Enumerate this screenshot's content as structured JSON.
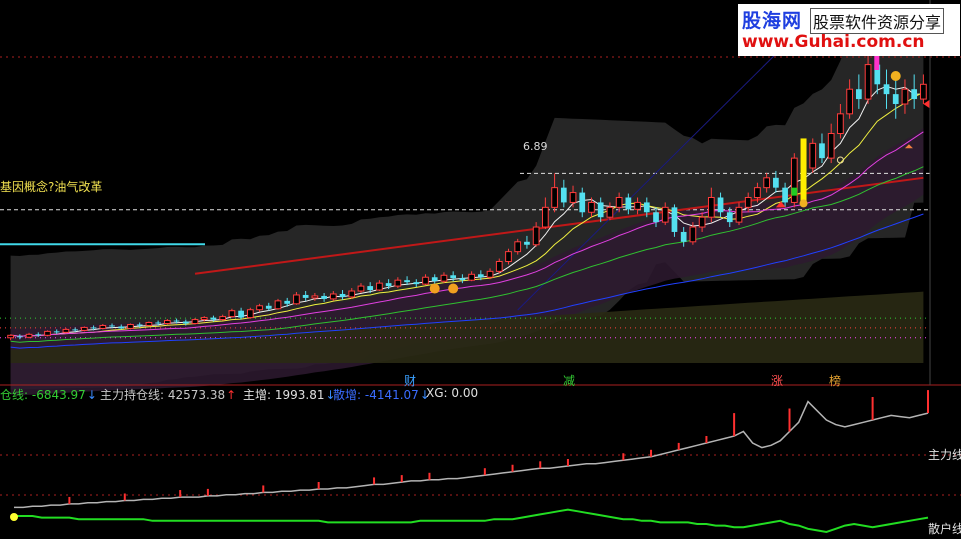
{
  "watermark": {
    "brand": "股海网",
    "tagline": "股票软件资源分享",
    "url": "www.Guhai.com.cn"
  },
  "annotations": {
    "concept_label": "基因概念?油气改革",
    "price_label": "6.89"
  },
  "event_markers": [
    {
      "label": "财",
      "color": "#3aa0ff"
    },
    {
      "label": "减",
      "color": "#33cc33"
    },
    {
      "label": "涨",
      "color": "#ff5050"
    },
    {
      "label": "榜",
      "color": "#e0a030"
    }
  ],
  "indicators": [
    {
      "name": "仓线:",
      "value": "-6843.97",
      "arrow": "↓",
      "name_color": "#33cc33",
      "value_color": "#33cc33",
      "arrow_color": "#3a8cff"
    },
    {
      "name": "主力持仓线:",
      "value": "42573.38",
      "arrow": "↑",
      "name_color": "#c8c8c8",
      "value_color": "#c8c8c8",
      "arrow_color": "#ff3030"
    },
    {
      "name": "主增:",
      "value": "1993.81",
      "arrow": "↓",
      "name_color": "#e0e0e0",
      "value_color": "#e0e0e0",
      "arrow_color": "#3a8cff"
    },
    {
      "name": "散增:",
      "value": "-4141.07",
      "arrow": "↓",
      "name_color": "#3a6cff",
      "value_color": "#3a6cff",
      "arrow_color": "#3a8cff"
    },
    {
      "name": "XG:",
      "value": "0.00",
      "arrow": "",
      "name_color": "#e0e0e0",
      "value_color": "#e0e0e0",
      "arrow_color": "#e0e0e0"
    }
  ],
  "lower_labels": {
    "main_line": "主力线",
    "retail_line": "散户线"
  },
  "chart_data": [
    {
      "type": "candlestick",
      "ylim": [
        3.2,
        9.6
      ],
      "candles": [
        [
          3.55,
          3.6,
          3.5,
          3.62
        ],
        [
          3.58,
          3.56,
          3.52,
          3.62
        ],
        [
          3.56,
          3.62,
          3.54,
          3.65
        ],
        [
          3.62,
          3.6,
          3.57,
          3.66
        ],
        [
          3.6,
          3.68,
          3.58,
          3.7
        ],
        [
          3.68,
          3.66,
          3.63,
          3.72
        ],
        [
          3.66,
          3.72,
          3.64,
          3.75
        ],
        [
          3.72,
          3.7,
          3.67,
          3.76
        ],
        [
          3.7,
          3.76,
          3.68,
          3.78
        ],
        [
          3.76,
          3.74,
          3.7,
          3.8
        ],
        [
          3.74,
          3.8,
          3.72,
          3.83
        ],
        [
          3.8,
          3.78,
          3.74,
          3.84
        ],
        [
          3.78,
          3.74,
          3.72,
          3.82
        ],
        [
          3.74,
          3.82,
          3.72,
          3.84
        ],
        [
          3.82,
          3.8,
          3.76,
          3.86
        ],
        [
          3.8,
          3.86,
          3.78,
          3.88
        ],
        [
          3.86,
          3.84,
          3.8,
          3.9
        ],
        [
          3.84,
          3.9,
          3.82,
          3.93
        ],
        [
          3.9,
          3.88,
          3.84,
          3.94
        ],
        [
          3.88,
          3.84,
          3.8,
          3.92
        ],
        [
          3.84,
          3.92,
          3.82,
          3.95
        ],
        [
          3.92,
          3.96,
          3.88,
          3.99
        ],
        [
          3.96,
          3.92,
          3.88,
          4.0
        ],
        [
          3.92,
          3.98,
          3.9,
          4.02
        ],
        [
          3.98,
          4.1,
          3.96,
          4.14
        ],
        [
          4.1,
          3.96,
          3.92,
          4.16
        ],
        [
          3.96,
          4.12,
          3.94,
          4.16
        ],
        [
          4.12,
          4.2,
          4.08,
          4.24
        ],
        [
          4.2,
          4.14,
          4.1,
          4.26
        ],
        [
          4.14,
          4.3,
          4.12,
          4.34
        ],
        [
          4.3,
          4.24,
          4.18,
          4.36
        ],
        [
          4.24,
          4.42,
          4.22,
          4.48
        ],
        [
          4.42,
          4.36,
          4.3,
          4.5
        ],
        [
          4.36,
          4.4,
          4.3,
          4.46
        ],
        [
          4.4,
          4.34,
          4.28,
          4.46
        ],
        [
          4.34,
          4.44,
          4.3,
          4.5
        ],
        [
          4.44,
          4.38,
          4.32,
          4.52
        ],
        [
          4.38,
          4.5,
          4.34,
          4.56
        ],
        [
          4.5,
          4.6,
          4.46,
          4.66
        ],
        [
          4.6,
          4.52,
          4.46,
          4.68
        ],
        [
          4.52,
          4.66,
          4.5,
          4.72
        ],
        [
          4.66,
          4.6,
          4.54,
          4.74
        ],
        [
          4.6,
          4.72,
          4.56,
          4.78
        ],
        [
          4.72,
          4.68,
          4.62,
          4.8
        ],
        [
          4.68,
          4.64,
          4.58,
          4.74
        ],
        [
          4.64,
          4.78,
          4.62,
          4.84
        ],
        [
          4.78,
          4.7,
          4.64,
          4.84
        ],
        [
          4.7,
          4.82,
          4.66,
          4.88
        ],
        [
          4.82,
          4.76,
          4.7,
          4.9
        ],
        [
          4.76,
          4.72,
          4.66,
          4.84
        ],
        [
          4.72,
          4.84,
          4.7,
          4.9
        ],
        [
          4.84,
          4.78,
          4.72,
          4.92
        ],
        [
          4.78,
          4.9,
          4.74,
          4.96
        ],
        [
          4.9,
          5.1,
          4.86,
          5.16
        ],
        [
          5.1,
          5.3,
          5.04,
          5.36
        ],
        [
          5.3,
          5.5,
          5.24,
          5.56
        ],
        [
          5.5,
          5.44,
          5.36,
          5.62
        ],
        [
          5.44,
          5.8,
          5.4,
          5.9
        ],
        [
          5.8,
          6.2,
          5.76,
          6.4
        ],
        [
          6.2,
          6.6,
          6.1,
          6.89
        ],
        [
          6.6,
          6.3,
          6.2,
          6.76
        ],
        [
          6.3,
          6.5,
          6.2,
          6.64
        ],
        [
          6.5,
          6.1,
          6.0,
          6.6
        ],
        [
          6.1,
          6.3,
          6.0,
          6.4
        ],
        [
          6.3,
          6.0,
          5.9,
          6.4
        ],
        [
          6.0,
          6.2,
          5.94,
          6.3
        ],
        [
          6.2,
          6.4,
          6.1,
          6.5
        ],
        [
          6.4,
          6.16,
          6.06,
          6.48
        ],
        [
          6.16,
          6.3,
          6.06,
          6.4
        ],
        [
          6.3,
          6.1,
          6.0,
          6.4
        ],
        [
          6.1,
          5.9,
          5.8,
          6.2
        ],
        [
          5.9,
          6.2,
          5.84,
          6.3
        ],
        [
          6.2,
          5.7,
          5.6,
          6.26
        ],
        [
          5.7,
          5.5,
          5.4,
          5.8
        ],
        [
          5.5,
          5.8,
          5.44,
          5.9
        ],
        [
          5.8,
          6.0,
          5.7,
          6.1
        ],
        [
          6.0,
          6.4,
          5.9,
          6.6
        ],
        [
          6.4,
          6.1,
          6.0,
          6.5
        ],
        [
          6.1,
          5.9,
          5.8,
          6.2
        ],
        [
          5.9,
          6.2,
          5.84,
          6.3
        ],
        [
          6.2,
          6.4,
          6.1,
          6.5
        ],
        [
          6.4,
          6.6,
          6.3,
          6.7
        ],
        [
          6.6,
          6.8,
          6.5,
          6.9
        ],
        [
          6.8,
          6.6,
          6.5,
          6.94
        ],
        [
          6.6,
          6.3,
          6.2,
          6.7
        ],
        [
          6.3,
          7.2,
          6.2,
          7.3
        ],
        [
          7.2,
          7.0,
          6.9,
          7.4
        ],
        [
          7.0,
          7.5,
          6.9,
          7.6
        ],
        [
          7.5,
          7.2,
          7.1,
          7.7
        ],
        [
          7.2,
          7.7,
          7.1,
          7.9
        ],
        [
          7.7,
          8.1,
          7.6,
          8.3
        ],
        [
          8.1,
          8.6,
          8.0,
          8.8
        ],
        [
          8.6,
          8.4,
          8.2,
          8.9
        ],
        [
          8.4,
          9.1,
          8.3,
          9.4
        ],
        [
          9.1,
          8.7,
          8.5,
          9.3
        ],
        [
          8.7,
          8.5,
          8.2,
          9.0
        ],
        [
          8.5,
          8.3,
          8.0,
          8.8
        ],
        [
          8.3,
          8.6,
          8.1,
          8.8
        ],
        [
          8.6,
          8.4,
          8.2,
          8.9
        ],
        [
          8.4,
          8.7,
          8.3,
          8.9
        ]
      ],
      "moving_averages": [
        {
          "name": "MA5",
          "color": "#f0f0f0"
        },
        {
          "name": "MA10",
          "color": "#f0f040"
        },
        {
          "name": "MA20",
          "color": "#e040e0"
        },
        {
          "name": "MA30",
          "color": "#30c030"
        },
        {
          "name": "MA60",
          "color": "#2040ff"
        }
      ],
      "reference_lines": [
        {
          "value": 6.89,
          "color": "#e0e0e0",
          "style": "dashed"
        },
        {
          "value": 6.15,
          "color": "#e0e0e0",
          "style": "dashed"
        },
        {
          "value": 3.95,
          "color": "#33cc33",
          "style": "dotted"
        },
        {
          "value": 3.75,
          "color": "#ff4040",
          "style": "dotted"
        },
        {
          "value": 3.55,
          "color": "#ff40ff",
          "style": "dotted"
        }
      ],
      "trend_line": {
        "color": "#c01818",
        "from": 4.85,
        "to": 6.8
      },
      "level_line": {
        "color": "#40d8e8",
        "value": 5.45
      }
    },
    {
      "type": "line",
      "series": [
        {
          "name": "主力线",
          "color": "#b4b4b4",
          "values": [
            4,
            4,
            5,
            5,
            6,
            6,
            7,
            7,
            8,
            8,
            9,
            9,
            10,
            10,
            11,
            11,
            12,
            12,
            13,
            13,
            13,
            14,
            14,
            15,
            15,
            16,
            16,
            17,
            17,
            18,
            18,
            19,
            19,
            20,
            20,
            21,
            21,
            22,
            23,
            24,
            24,
            25,
            26,
            27,
            27,
            28,
            28,
            29,
            29,
            30,
            31,
            32,
            33,
            34,
            35,
            36,
            37,
            38,
            38,
            39,
            40,
            41,
            42,
            42,
            43,
            44,
            45,
            46,
            47,
            48,
            50,
            52,
            54,
            56,
            58,
            60,
            62,
            64,
            66,
            70,
            60,
            56,
            58,
            62,
            70,
            78,
            96,
            88,
            80,
            76,
            74,
            76,
            78,
            80,
            82,
            84,
            83,
            82,
            84,
            86
          ]
        },
        {
          "name": "散户线",
          "color": "#22dd22",
          "values": [
            0,
            0,
            0,
            -1,
            -1,
            -1,
            -1,
            -2,
            -2,
            -2,
            -2,
            -2,
            -2,
            -2,
            -2,
            -3,
            -3,
            -3,
            -3,
            -3,
            -3,
            -3,
            -3,
            -3,
            -3,
            -3,
            -3,
            -3,
            -3,
            -3,
            -3,
            -3,
            -3,
            -3,
            -4,
            -4,
            -4,
            -4,
            -4,
            -4,
            -4,
            -4,
            -4,
            -4,
            -3,
            -3,
            -3,
            -3,
            -3,
            -3,
            -3,
            -3,
            -2,
            -2,
            -2,
            -1,
            0,
            1,
            2,
            3,
            4,
            3,
            2,
            1,
            0,
            -1,
            -2,
            -2,
            -3,
            -3,
            -4,
            -4,
            -4,
            -4,
            -5,
            -5,
            -6,
            -6,
            -7,
            -7,
            -6,
            -5,
            -4,
            -3,
            -5,
            -6,
            -8,
            -9,
            -10,
            -8,
            -6,
            -5,
            -6,
            -7,
            -6,
            -5,
            -4,
            -3,
            -2,
            -1
          ]
        }
      ]
    }
  ]
}
